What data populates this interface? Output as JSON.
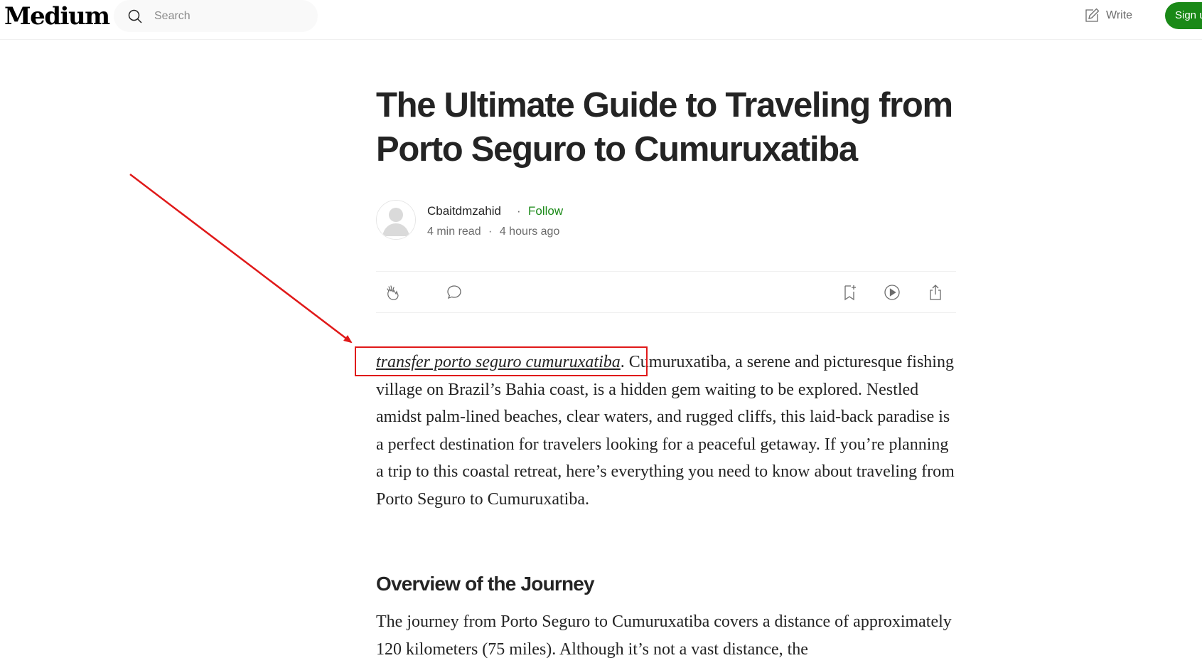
{
  "header": {
    "logo": "Medium",
    "search_placeholder": "Search",
    "write_label": "Write",
    "signup_label": "Sign up"
  },
  "article": {
    "title": "The Ultimate Guide to Traveling from Porto Seguro to Cumuruxatiba",
    "author": "Cbaitdmzahid",
    "separator": "·",
    "follow_label": "Follow",
    "read_time": "4 min read",
    "meta_separator": "·",
    "published": "4 hours ago",
    "actions": [
      "clap-icon",
      "comment-icon",
      "bookmark-icon",
      "listen-icon",
      "share-icon"
    ],
    "intro_link": "transfer porto seguro cumuruxatiba",
    "intro_rest": ". Cumuruxatiba, a serene and picturesque fishing village on Brazil’s Bahia coast, is a hidden gem waiting to be explored. Nestled amidst palm-lined beaches, clear waters, and rugged cliffs, this laid-back paradise is a perfect destination for travelers looking for a peaceful getaway. If you’re planning a trip to this coastal retreat, here’s everything you need to know about traveling from Porto Seguro to Cumuruxatiba.",
    "section_heading": "Overview of the Journey",
    "section_text": "The journey from Porto Seguro to Cumuruxatiba covers a distance of approximately 120 kilometers (75 miles). Although it’s not a vast distance, the"
  },
  "colors": {
    "brand_green": "#1a8917",
    "annotation_red": "#e01919",
    "text": "#242424",
    "muted": "#6b6b6b"
  }
}
